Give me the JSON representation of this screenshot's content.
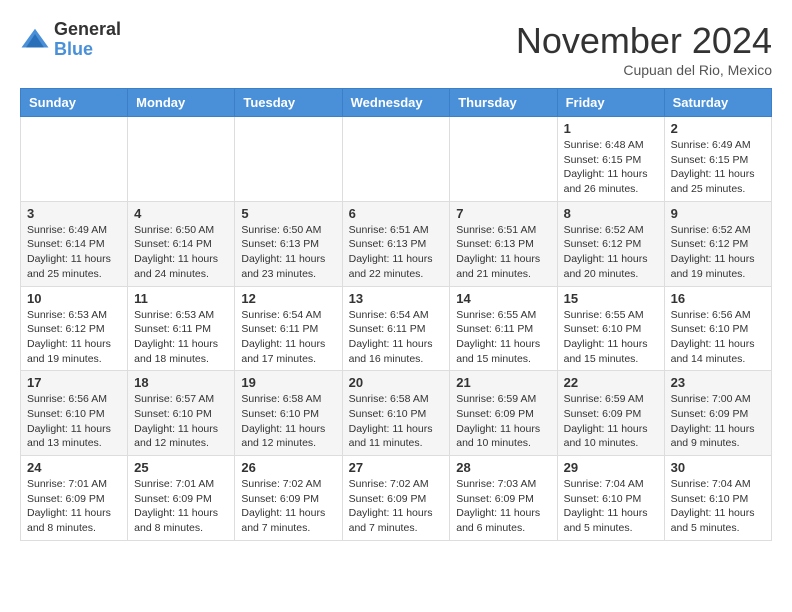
{
  "logo": {
    "general": "General",
    "blue": "Blue"
  },
  "title": "November 2024",
  "subtitle": "Cupuan del Rio, Mexico",
  "days_of_week": [
    "Sunday",
    "Monday",
    "Tuesday",
    "Wednesday",
    "Thursday",
    "Friday",
    "Saturday"
  ],
  "weeks": [
    [
      {
        "day": "",
        "info": ""
      },
      {
        "day": "",
        "info": ""
      },
      {
        "day": "",
        "info": ""
      },
      {
        "day": "",
        "info": ""
      },
      {
        "day": "",
        "info": ""
      },
      {
        "day": "1",
        "info": "Sunrise: 6:48 AM\nSunset: 6:15 PM\nDaylight: 11 hours and 26 minutes."
      },
      {
        "day": "2",
        "info": "Sunrise: 6:49 AM\nSunset: 6:15 PM\nDaylight: 11 hours and 25 minutes."
      }
    ],
    [
      {
        "day": "3",
        "info": "Sunrise: 6:49 AM\nSunset: 6:14 PM\nDaylight: 11 hours and 25 minutes."
      },
      {
        "day": "4",
        "info": "Sunrise: 6:50 AM\nSunset: 6:14 PM\nDaylight: 11 hours and 24 minutes."
      },
      {
        "day": "5",
        "info": "Sunrise: 6:50 AM\nSunset: 6:13 PM\nDaylight: 11 hours and 23 minutes."
      },
      {
        "day": "6",
        "info": "Sunrise: 6:51 AM\nSunset: 6:13 PM\nDaylight: 11 hours and 22 minutes."
      },
      {
        "day": "7",
        "info": "Sunrise: 6:51 AM\nSunset: 6:13 PM\nDaylight: 11 hours and 21 minutes."
      },
      {
        "day": "8",
        "info": "Sunrise: 6:52 AM\nSunset: 6:12 PM\nDaylight: 11 hours and 20 minutes."
      },
      {
        "day": "9",
        "info": "Sunrise: 6:52 AM\nSunset: 6:12 PM\nDaylight: 11 hours and 19 minutes."
      }
    ],
    [
      {
        "day": "10",
        "info": "Sunrise: 6:53 AM\nSunset: 6:12 PM\nDaylight: 11 hours and 19 minutes."
      },
      {
        "day": "11",
        "info": "Sunrise: 6:53 AM\nSunset: 6:11 PM\nDaylight: 11 hours and 18 minutes."
      },
      {
        "day": "12",
        "info": "Sunrise: 6:54 AM\nSunset: 6:11 PM\nDaylight: 11 hours and 17 minutes."
      },
      {
        "day": "13",
        "info": "Sunrise: 6:54 AM\nSunset: 6:11 PM\nDaylight: 11 hours and 16 minutes."
      },
      {
        "day": "14",
        "info": "Sunrise: 6:55 AM\nSunset: 6:11 PM\nDaylight: 11 hours and 15 minutes."
      },
      {
        "day": "15",
        "info": "Sunrise: 6:55 AM\nSunset: 6:10 PM\nDaylight: 11 hours and 15 minutes."
      },
      {
        "day": "16",
        "info": "Sunrise: 6:56 AM\nSunset: 6:10 PM\nDaylight: 11 hours and 14 minutes."
      }
    ],
    [
      {
        "day": "17",
        "info": "Sunrise: 6:56 AM\nSunset: 6:10 PM\nDaylight: 11 hours and 13 minutes."
      },
      {
        "day": "18",
        "info": "Sunrise: 6:57 AM\nSunset: 6:10 PM\nDaylight: 11 hours and 12 minutes."
      },
      {
        "day": "19",
        "info": "Sunrise: 6:58 AM\nSunset: 6:10 PM\nDaylight: 11 hours and 12 minutes."
      },
      {
        "day": "20",
        "info": "Sunrise: 6:58 AM\nSunset: 6:10 PM\nDaylight: 11 hours and 11 minutes."
      },
      {
        "day": "21",
        "info": "Sunrise: 6:59 AM\nSunset: 6:09 PM\nDaylight: 11 hours and 10 minutes."
      },
      {
        "day": "22",
        "info": "Sunrise: 6:59 AM\nSunset: 6:09 PM\nDaylight: 11 hours and 10 minutes."
      },
      {
        "day": "23",
        "info": "Sunrise: 7:00 AM\nSunset: 6:09 PM\nDaylight: 11 hours and 9 minutes."
      }
    ],
    [
      {
        "day": "24",
        "info": "Sunrise: 7:01 AM\nSunset: 6:09 PM\nDaylight: 11 hours and 8 minutes."
      },
      {
        "day": "25",
        "info": "Sunrise: 7:01 AM\nSunset: 6:09 PM\nDaylight: 11 hours and 8 minutes."
      },
      {
        "day": "26",
        "info": "Sunrise: 7:02 AM\nSunset: 6:09 PM\nDaylight: 11 hours and 7 minutes."
      },
      {
        "day": "27",
        "info": "Sunrise: 7:02 AM\nSunset: 6:09 PM\nDaylight: 11 hours and 7 minutes."
      },
      {
        "day": "28",
        "info": "Sunrise: 7:03 AM\nSunset: 6:09 PM\nDaylight: 11 hours and 6 minutes."
      },
      {
        "day": "29",
        "info": "Sunrise: 7:04 AM\nSunset: 6:10 PM\nDaylight: 11 hours and 5 minutes."
      },
      {
        "day": "30",
        "info": "Sunrise: 7:04 AM\nSunset: 6:10 PM\nDaylight: 11 hours and 5 minutes."
      }
    ]
  ]
}
